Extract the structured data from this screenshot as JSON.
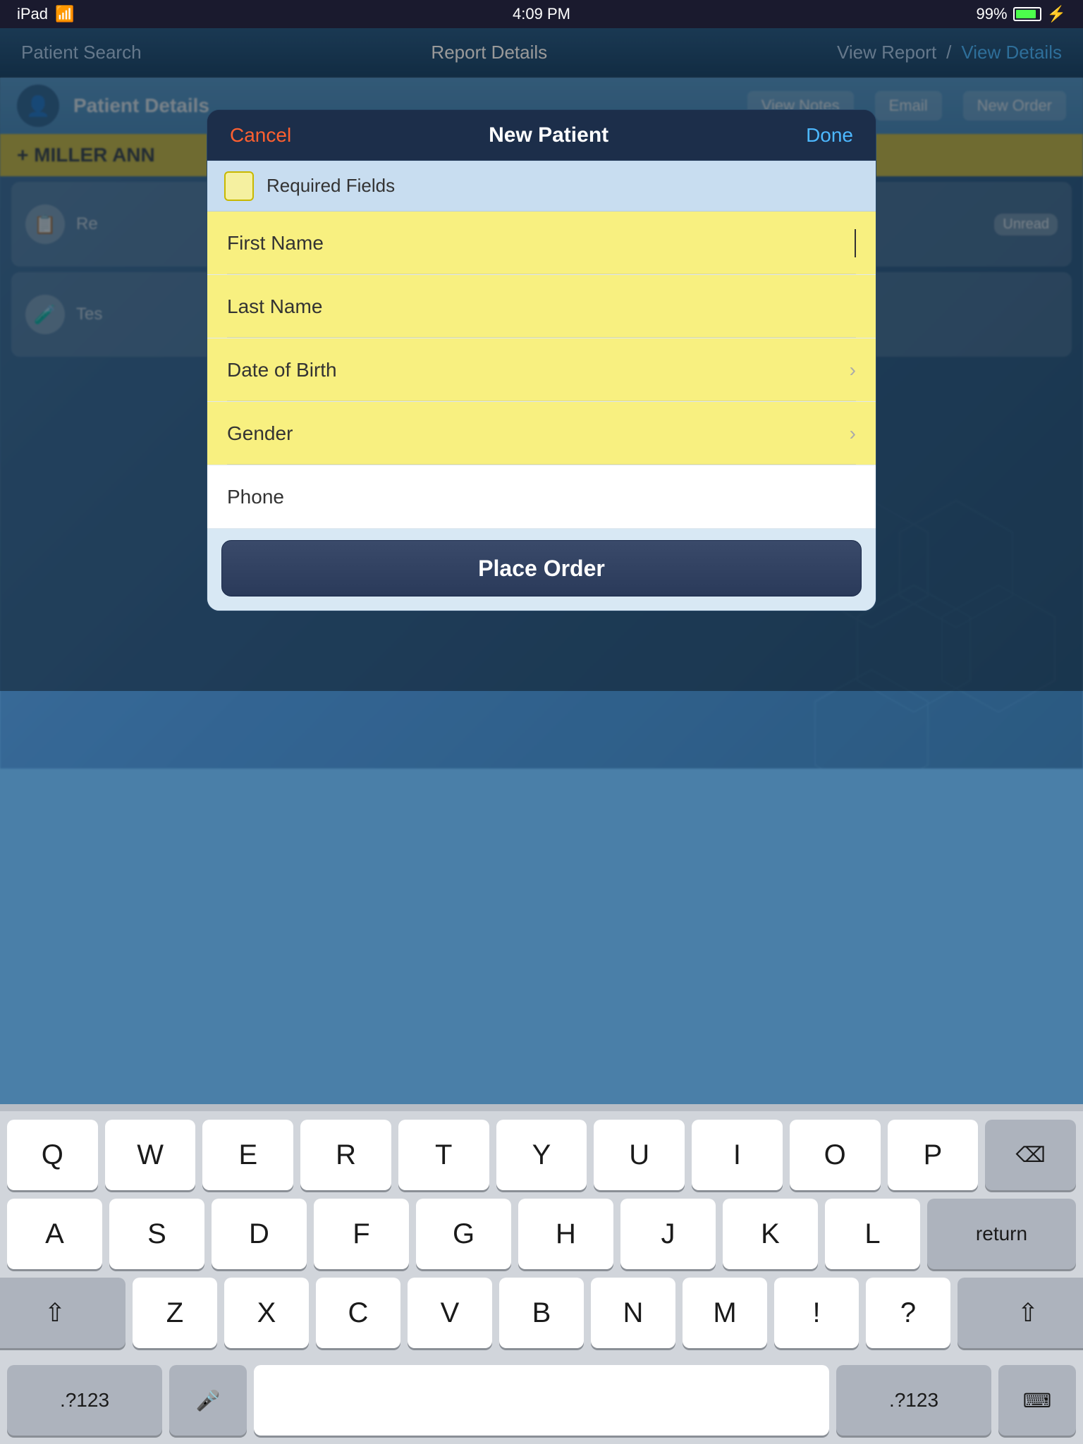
{
  "statusBar": {
    "device": "iPad",
    "wifi": "wifi",
    "time": "4:09 PM",
    "battery": "99%",
    "charging": true
  },
  "navBar": {
    "left": "Patient Search",
    "center": "Report Details",
    "right1": "View Report",
    "divider": "/",
    "right2": "View Details"
  },
  "patientHeader": {
    "title": "Patient Details",
    "btn1": "View Notes",
    "btn2": "Email",
    "btn3": "New Order"
  },
  "patientName": "MILLER ANN",
  "modal": {
    "cancelLabel": "Cancel",
    "title": "New Patient",
    "doneLabel": "Done",
    "requiredFieldsLabel": "Required Fields",
    "fields": [
      {
        "label": "First Name",
        "type": "text",
        "required": true,
        "hasCursor": true,
        "hasChevron": false
      },
      {
        "label": "Last Name",
        "type": "text",
        "required": true,
        "hasCursor": false,
        "hasChevron": false
      },
      {
        "label": "Date of Birth",
        "type": "picker",
        "required": true,
        "hasCursor": false,
        "hasChevron": true
      },
      {
        "label": "Gender",
        "type": "picker",
        "required": true,
        "hasCursor": false,
        "hasChevron": true
      },
      {
        "label": "Phone",
        "type": "text",
        "required": false,
        "hasCursor": false,
        "hasChevron": false
      }
    ],
    "placeOrderLabel": "Place Order"
  },
  "keyboard": {
    "rows": [
      [
        "Q",
        "W",
        "E",
        "R",
        "T",
        "Y",
        "U",
        "I",
        "O",
        "P"
      ],
      [
        "A",
        "S",
        "D",
        "F",
        "G",
        "H",
        "J",
        "K",
        "L"
      ],
      [
        "Z",
        "X",
        "C",
        "V",
        "B",
        "N",
        "M",
        "!",
        "?"
      ]
    ],
    "deleteLabel": "⌫",
    "returnLabel": "return",
    "shiftLabel": "⇧",
    "numLabel": ".?123",
    "micLabel": "🎤",
    "spaceLabel": "",
    "keyboardDismissLabel": "⌨"
  },
  "bgItems": [
    {
      "icon": "📋",
      "text": "Re",
      "badge": "Unread"
    },
    {
      "icon": "🧪",
      "text": "Tes",
      "badge": ""
    }
  ],
  "colors": {
    "accent": "#4db8ff",
    "cancel": "#ff6030",
    "requiredYellow": "#f8f080",
    "placeOrderBg": "#2a3a5a",
    "navBg": "#1e4a70"
  }
}
